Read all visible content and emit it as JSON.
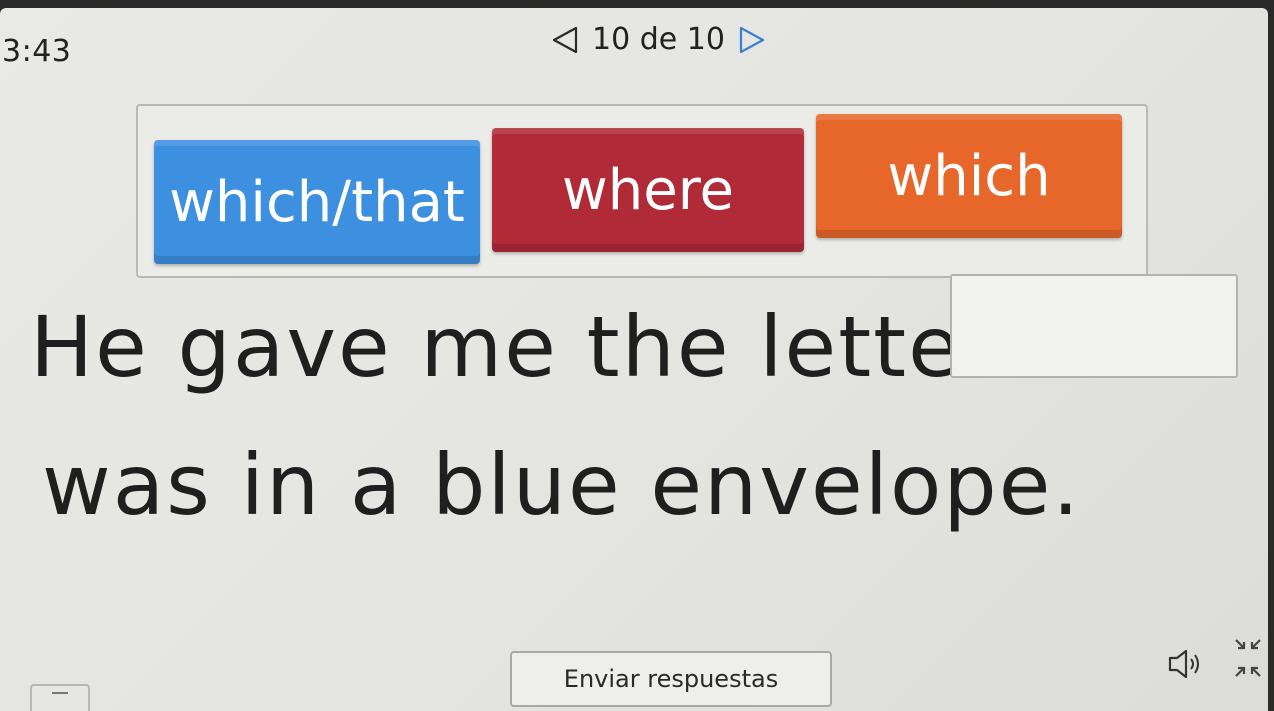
{
  "timer": "3:43",
  "pager": {
    "counter": "10 de 10",
    "prev_icon": "triangle-left-outline",
    "next_icon": "triangle-right-outline"
  },
  "options": [
    {
      "label": "which/that",
      "color": "#3d8fe0"
    },
    {
      "label": "where",
      "color": "#b02a38"
    },
    {
      "label": "which",
      "color": "#e7672b"
    }
  ],
  "question": {
    "line1": "He gave me the letter",
    "line2": "was in a blue envelope.",
    "blank_value": ""
  },
  "footer": {
    "submit_label": "Enviar respuestas",
    "audio_icon": "speaker-icon",
    "fullscreen_icon": "expand-arrows-icon"
  }
}
